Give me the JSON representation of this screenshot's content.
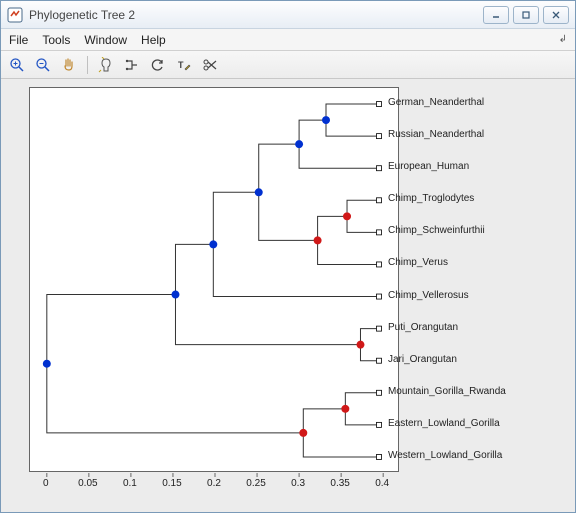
{
  "window": {
    "title": "Phylogenetic Tree 2"
  },
  "menu": {
    "file": "File",
    "tools": "Tools",
    "window": "Window",
    "help": "Help"
  },
  "toolbar_icons": {
    "zoom_in": "zoom-in-icon",
    "zoom_out": "zoom-out-icon",
    "pan": "pan-icon",
    "inspect": "inspect-icon",
    "collapse": "collapse-icon",
    "rotate": "rotate-icon",
    "rename": "rename-icon",
    "prune": "prune-icon"
  },
  "axis": {
    "ticks": [
      0,
      0.05,
      0.1,
      0.15,
      0.2,
      0.25,
      0.3,
      0.35,
      0.4
    ],
    "tick_labels": [
      "0",
      "0.05",
      "0.1",
      "0.15",
      "0.2",
      "0.25",
      "0.3",
      "0.35",
      "0.4"
    ]
  },
  "tree": {
    "leaves": [
      {
        "name": "German_Neanderthal",
        "x": 0.395
      },
      {
        "name": "Russian_Neanderthal",
        "x": 0.395
      },
      {
        "name": "European_Human",
        "x": 0.395
      },
      {
        "name": "Chimp_Troglodytes",
        "x": 0.395
      },
      {
        "name": "Chimp_Schweinfurthii",
        "x": 0.395
      },
      {
        "name": "Chimp_Verus",
        "x": 0.395
      },
      {
        "name": "Chimp_Vellerosus",
        "x": 0.395
      },
      {
        "name": "Puti_Orangutan",
        "x": 0.395
      },
      {
        "name": "Jari_Orangutan",
        "x": 0.395
      },
      {
        "name": "Mountain_Gorilla_Rwanda",
        "x": 0.395
      },
      {
        "name": "Eastern_Lowland_Gorilla",
        "x": 0.395
      },
      {
        "name": "Western_Lowland_Gorilla",
        "x": 0.395
      }
    ],
    "internal_nodes": [
      {
        "id": "n_neanderthal",
        "x": 0.332,
        "children_y": [
          0,
          1
        ],
        "color": "blue"
      },
      {
        "id": "n_neo_eur",
        "x": 0.3,
        "children_y": [
          "n_neanderthal",
          2
        ],
        "color": "blue"
      },
      {
        "id": "n_chimp_ts",
        "x": 0.357,
        "children_y": [
          3,
          4
        ],
        "color": "red"
      },
      {
        "id": "n_chimp_tsv",
        "x": 0.322,
        "children_y": [
          "n_chimp_ts",
          5
        ],
        "color": "red"
      },
      {
        "id": "n_human_chimp",
        "x": 0.252,
        "children_y": [
          "n_neo_eur",
          "n_chimp_tsv"
        ],
        "color": "blue"
      },
      {
        "id": "n_hc_veller",
        "x": 0.198,
        "children_y": [
          "n_human_chimp",
          6
        ],
        "color": "blue"
      },
      {
        "id": "n_orang",
        "x": 0.373,
        "children_y": [
          7,
          8
        ],
        "color": "red"
      },
      {
        "id": "n_hcv_orang",
        "x": 0.153,
        "children_y": [
          "n_hc_veller",
          "n_orang"
        ],
        "color": "blue"
      },
      {
        "id": "n_gor_me",
        "x": 0.355,
        "children_y": [
          9,
          10
        ],
        "color": "red"
      },
      {
        "id": "n_gor_all",
        "x": 0.305,
        "children_y": [
          "n_gor_me",
          11
        ],
        "color": "red"
      },
      {
        "id": "n_root",
        "x": 0.0,
        "children_y": [
          "n_hcv_orang",
          "n_gor_all"
        ],
        "color": "blue"
      }
    ]
  },
  "chart_data": {
    "type": "tree",
    "title": "",
    "xlabel": "",
    "ylabel": "",
    "xlim": [
      -0.02,
      0.42
    ],
    "leaves_order": [
      "German_Neanderthal",
      "Russian_Neanderthal",
      "European_Human",
      "Chimp_Troglodytes",
      "Chimp_Schweinfurthii",
      "Chimp_Verus",
      "Chimp_Vellerosus",
      "Puti_Orangutan",
      "Jari_Orangutan",
      "Mountain_Gorilla_Rwanda",
      "Eastern_Lowland_Gorilla",
      "Western_Lowland_Gorilla"
    ],
    "branch_nodes": [
      {
        "x": 0.332,
        "joins": [
          "German_Neanderthal",
          "Russian_Neanderthal"
        ],
        "group": "blue"
      },
      {
        "x": 0.3,
        "joins": [
          "(German+Russian Neanderthal)",
          "European_Human"
        ],
        "group": "blue"
      },
      {
        "x": 0.357,
        "joins": [
          "Chimp_Troglodytes",
          "Chimp_Schweinfurthii"
        ],
        "group": "red"
      },
      {
        "x": 0.322,
        "joins": [
          "(Troglodytes+Schweinfurthii)",
          "Chimp_Verus"
        ],
        "group": "red"
      },
      {
        "x": 0.252,
        "joins": [
          "(Humans/Neanderthal)",
          "(Chimp TSV)"
        ],
        "group": "blue"
      },
      {
        "x": 0.198,
        "joins": [
          "(prev)",
          "Chimp_Vellerosus"
        ],
        "group": "blue"
      },
      {
        "x": 0.373,
        "joins": [
          "Puti_Orangutan",
          "Jari_Orangutan"
        ],
        "group": "red"
      },
      {
        "x": 0.153,
        "joins": [
          "(prev)",
          "(Orangutan)"
        ],
        "group": "blue"
      },
      {
        "x": 0.355,
        "joins": [
          "Mountain_Gorilla_Rwanda",
          "Eastern_Lowland_Gorilla"
        ],
        "group": "red"
      },
      {
        "x": 0.305,
        "joins": [
          "(Mountain+Eastern Gorilla)",
          "Western_Lowland_Gorilla"
        ],
        "group": "red"
      },
      {
        "x": 0.0,
        "joins": [
          "(Apes+Humans)",
          "(Gorillas)"
        ],
        "group": "blue"
      }
    ]
  }
}
